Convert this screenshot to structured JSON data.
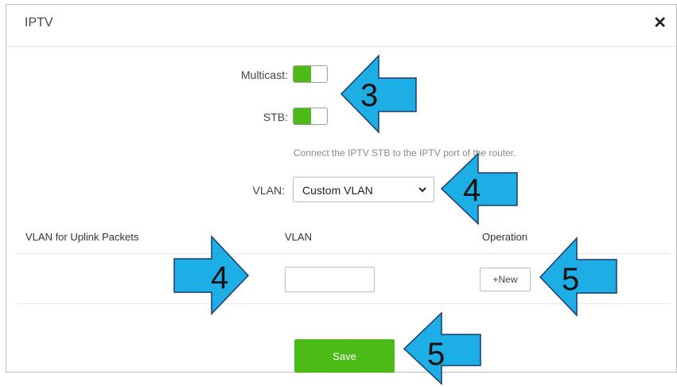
{
  "dialog": {
    "title": "IPTV",
    "close_glyph": "✕"
  },
  "multicast": {
    "label": "Multicast:",
    "enabled": true
  },
  "stb": {
    "label": "STB:",
    "enabled": true
  },
  "hint": "Connect the IPTV STB to the IPTV port of the router.",
  "vlan": {
    "label": "VLAN:",
    "selected": "Custom VLAN"
  },
  "table": {
    "headers": [
      "VLAN for Uplink Packets",
      "VLAN",
      "Operation"
    ],
    "vlan_input_value": "",
    "new_label": "+New"
  },
  "save_label": "Save",
  "annotations": [
    {
      "number": "3",
      "direction": "left"
    },
    {
      "number": "4",
      "direction": "left"
    },
    {
      "number": "4",
      "direction": "right"
    },
    {
      "number": "5",
      "direction": "left"
    },
    {
      "number": "5",
      "direction": "left"
    }
  ],
  "colors": {
    "accent_green": "#4cbb17",
    "arrow_fill": "#1eaee6",
    "arrow_stroke": "#1a3a6b"
  },
  "icons": {
    "close": "close-icon",
    "select_chevron": "chevron-down-icon"
  }
}
